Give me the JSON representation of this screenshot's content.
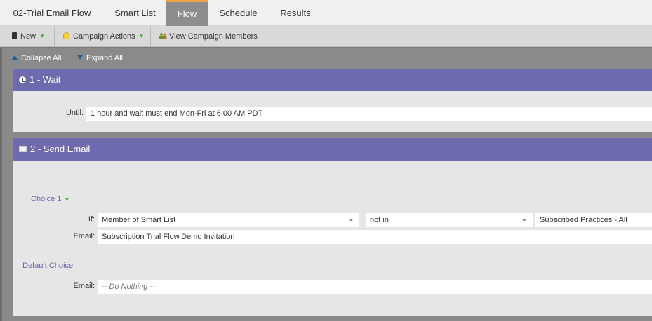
{
  "tabs": [
    {
      "label": "02-Trial Email Flow"
    },
    {
      "label": "Smart List"
    },
    {
      "label": "Flow"
    },
    {
      "label": "Schedule"
    },
    {
      "label": "Results"
    }
  ],
  "active_tab": "Flow",
  "toolbar": {
    "new_label": "New",
    "campaign_actions_label": "Campaign Actions",
    "view_members_label": "View Campaign Members",
    "dropdown_glyph": "▼"
  },
  "flow_controls": {
    "collapse_all": "Collapse All",
    "expand_all": "Expand All"
  },
  "steps": [
    {
      "title": "1 - Wait",
      "icon": "clock-icon",
      "until_label": "Until:",
      "until_value": "1 hour and wait must end Mon-Fri at 6:00 AM PDT"
    },
    {
      "title": "2 - Send Email",
      "icon": "envelope-icon",
      "choice1": {
        "label": "Choice 1",
        "if_label": "If:",
        "condition_field": "Member of Smart List",
        "operator": "not in",
        "value": "Subscribed Practices - All",
        "email_label": "Email:",
        "email_value": "Subscription Trial Flow.Demo Invitation"
      },
      "default_choice": {
        "label": "Default Choice",
        "email_label": "Email:",
        "email_value": "-- Do Nothing --"
      }
    }
  ],
  "colors": {
    "step_header": "#6e6aae",
    "active_tab_accent": "#f0a24a",
    "choice_text": "#6b64b7"
  }
}
